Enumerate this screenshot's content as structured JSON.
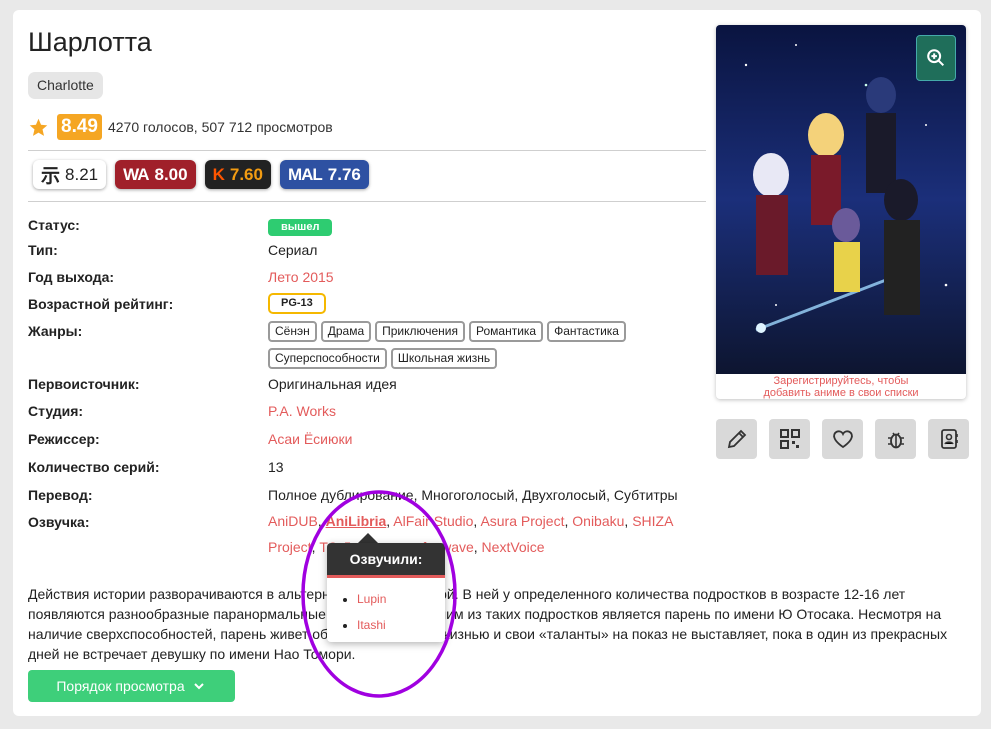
{
  "anime": {
    "title": "Шарлотта",
    "alt_title": "Charlotte",
    "score": "8.49",
    "votes_text": "4270 голосов, 507 712 просмотров"
  },
  "external_ratings": [
    {
      "source": "shikimori",
      "logo": "示",
      "value": "8.21"
    },
    {
      "source": "world-art",
      "logo": "WA",
      "value": "8.00"
    },
    {
      "source": "kinopoisk",
      "logo": "K",
      "value": "7.60"
    },
    {
      "source": "mal",
      "logo": "MAL",
      "value": "7.76"
    }
  ],
  "info": {
    "status_label": "Статус:",
    "status_value": "вышел",
    "type_label": "Тип:",
    "type_value": "Сериал",
    "year_label": "Год выхода:",
    "year_value": "Лето 2015",
    "age_label": "Возрастной рейтинг:",
    "age_value": "PG-13",
    "genres_label": "Жанры:",
    "genres": [
      "Сёнэн",
      "Драма",
      "Приключения",
      "Романтика",
      "Фантастика",
      "Суперспособности",
      "Школьная жизнь"
    ],
    "source_label": "Первоисточник:",
    "source_value": "Оригинальная идея",
    "studio_label": "Студия:",
    "studio_value": "P.A. Works",
    "director_label": "Режиссер:",
    "director_value": "Асаи Ёсиюки",
    "episodes_label": "Количество серий:",
    "episodes_value": "13",
    "translation_label": "Перевод:",
    "translation_value": "Полное дублирование, Многоголосый, Двухголосый, Субтитры",
    "dub_label": "Озвучка:",
    "dubs": [
      "AniDUB",
      "AniLibria",
      "AlFair Studio",
      "Asura Project",
      "Onibaku",
      "SHIZA Project",
      "ТО Дубляжная",
      "foxwave",
      "NextVoice"
    ]
  },
  "description": "Действия истории разворачиваются в альтернативной вселенной. В ней у определенного количества подростков в возрасте 12-16 лет появляются разнообразные паранормальные способности. Одним из таких подростков является парень по имени Ю Отосака. Несмотря на наличие сверхспособностей, парень живет обычной школьной жизнью и свои «таланты» на показ не выставляет, пока в один из прекрасных дней не встречает девушку по имени Нао Томори.",
  "order_button": "Порядок просмотра",
  "poster": {
    "caption_line1": "Зарегистрируйтесь, чтобы",
    "caption_line2": "добавить аниме в свои списки"
  },
  "tooltip": {
    "title": "Озвучили:",
    "voices": [
      "Lupin",
      "Itashi"
    ]
  },
  "colors": {
    "accent": "#e35b5b",
    "score_bg": "#f5a623",
    "status_green": "#2ecc71",
    "button_green": "#3ecf7a",
    "annotation": "#a000e0"
  },
  "icons": [
    "star-icon",
    "zoom-icon",
    "edit-icon",
    "qr-icon",
    "heart-icon",
    "bug-icon",
    "contacts-icon",
    "chevron-down-icon"
  ]
}
